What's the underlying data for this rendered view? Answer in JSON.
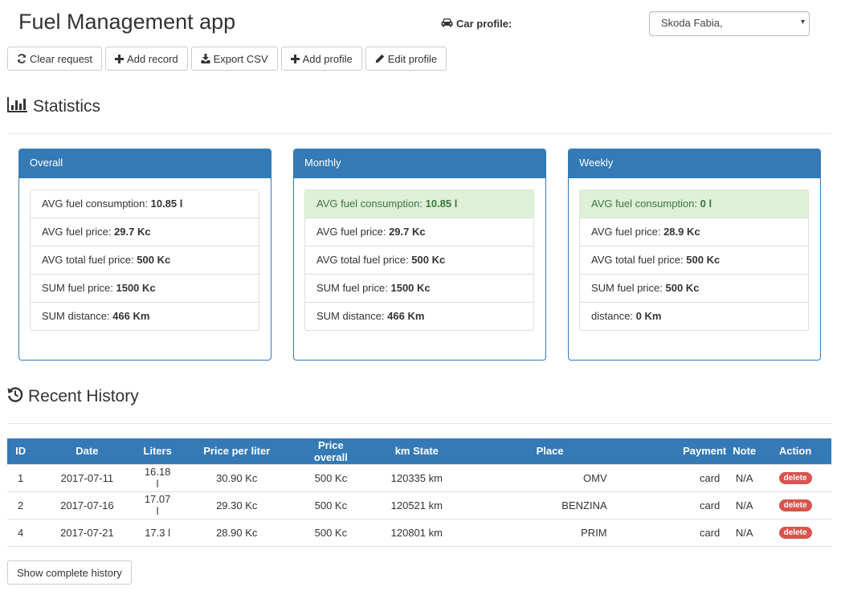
{
  "app": {
    "title": "Fuel Management app"
  },
  "car_profile": {
    "label": "Car profile:",
    "selected": "Skoda Fabia,"
  },
  "toolbar": {
    "clear": "Clear request",
    "add_record": "Add record",
    "export_csv": "Export CSV",
    "add_profile": "Add profile",
    "edit_profile": "Edit profile"
  },
  "statistics": {
    "title": "Statistics",
    "panels": [
      {
        "heading": "Overall",
        "items": [
          {
            "label": "AVG fuel consumption: ",
            "value": "10.85 l",
            "highlight": false
          },
          {
            "label": "AVG fuel price: ",
            "value": "29.7 Kc"
          },
          {
            "label": "AVG total fuel price: ",
            "value": "500 Kc"
          },
          {
            "label": "SUM fuel price: ",
            "value": "1500 Kc"
          },
          {
            "label": "SUM distance: ",
            "value": "466 Km"
          }
        ]
      },
      {
        "heading": "Monthly",
        "items": [
          {
            "label": "AVG fuel consumption: ",
            "value": "10.85 l",
            "highlight": true
          },
          {
            "label": "AVG fuel price: ",
            "value": "29.7 Kc"
          },
          {
            "label": "AVG total fuel price: ",
            "value": "500 Kc"
          },
          {
            "label": "SUM fuel price: ",
            "value": "1500 Kc"
          },
          {
            "label": "SUM distance: ",
            "value": "466 Km"
          }
        ]
      },
      {
        "heading": "Weekly",
        "items": [
          {
            "label": "AVG fuel consumption: ",
            "value": "0 l",
            "highlight": true
          },
          {
            "label": "AVG fuel price: ",
            "value": "28.9 Kc"
          },
          {
            "label": "AVG total fuel price: ",
            "value": "500 Kc"
          },
          {
            "label": "SUM fuel price: ",
            "value": "500 Kc"
          },
          {
            "label": "distance: ",
            "value": "0 Km"
          }
        ]
      }
    ]
  },
  "history": {
    "title": "Recent History",
    "columns": [
      "ID",
      "Date",
      "Liters",
      "Price per liter",
      "Price overall",
      "km State",
      "Place",
      "Payment",
      "Note",
      "Action"
    ],
    "rows": [
      {
        "id": "1",
        "date": "2017-07-11",
        "liters": "16.18 l",
        "ppl": "30.90 Kc",
        "overall": "500 Kc",
        "km": "120335 km",
        "place": "OMV",
        "payment": "card",
        "note": "N/A",
        "action": "delete"
      },
      {
        "id": "2",
        "date": "2017-07-16",
        "liters": "17.07 l",
        "ppl": "29.30 Kc",
        "overall": "500 Kc",
        "km": "120521 km",
        "place": "BENZINA",
        "payment": "card",
        "note": "N/A",
        "action": "delete"
      },
      {
        "id": "4",
        "date": "2017-07-21",
        "liters": "17.3 l",
        "ppl": "28.90 Kc",
        "overall": "500 Kc",
        "km": "120801 km",
        "place": "PRIM",
        "payment": "card",
        "note": "N/A",
        "action": "delete"
      }
    ],
    "show_complete": "Show complete history"
  },
  "colors": {
    "primary": "#337ab7",
    "success_bg": "#dff0d8",
    "success_text": "#3c763d",
    "danger": "#d9534f"
  }
}
